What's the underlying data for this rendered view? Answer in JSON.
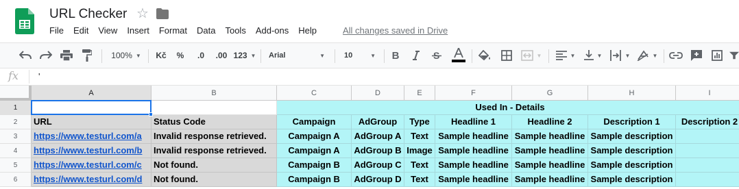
{
  "app": {
    "title": "URL Checker",
    "save_status": "All changes saved in Drive",
    "menu": [
      "File",
      "Edit",
      "View",
      "Insert",
      "Format",
      "Data",
      "Tools",
      "Add-ons",
      "Help"
    ]
  },
  "toolbar": {
    "zoom": "100%",
    "currency": "Kč",
    "percent": "%",
    "decrease_decimals": ".0",
    "increase_decimals": ".00",
    "more_formats": "123",
    "font": "Arial",
    "font_size": "10",
    "bold": "B",
    "accent_color": "#1a73e8",
    "text_color_bar": "#000000"
  },
  "formula_bar": {
    "fx_label": "fx",
    "value": "'"
  },
  "sheet": {
    "active_cell": "A1",
    "columns": [
      "A",
      "B",
      "C",
      "D",
      "E",
      "F",
      "G",
      "H",
      "I"
    ],
    "rows": [
      "1",
      "2",
      "3",
      "4",
      "5",
      "6"
    ],
    "header_merged": "Used In - Details",
    "headers": [
      "URL",
      "Status Code",
      "Campaign",
      "AdGroup",
      "Type",
      "Headline 1",
      "Headline 2",
      "Description 1",
      "Description 2"
    ],
    "data": [
      [
        "https://www.testurl.com/a",
        "Invalid response retrieved.",
        "Campaign A",
        "AdGroup A",
        "Text",
        "Sample headline",
        "Sample headline",
        "Sample description",
        ""
      ],
      [
        "https://www.testurl.com/b",
        "Invalid response retrieved.",
        "Campaign A",
        "AdGroup B",
        "Image",
        "Sample headline",
        "Sample headline",
        "Sample description",
        ""
      ],
      [
        "https://www.testurl.com/c",
        "Not found.",
        "Campaign B",
        "AdGroup C",
        "Text",
        "Sample headline",
        "Sample headline",
        "Sample description",
        ""
      ],
      [
        "https://www.testurl.com/d",
        "Not found.",
        "Campaign B",
        "AdGroup D",
        "Text",
        "Sample headline",
        "Sample headline",
        "Sample description",
        ""
      ]
    ],
    "colors": {
      "left_fill": "#d9d9d9",
      "right_fill": "#b3f5f7",
      "link": "#1155cc"
    }
  }
}
